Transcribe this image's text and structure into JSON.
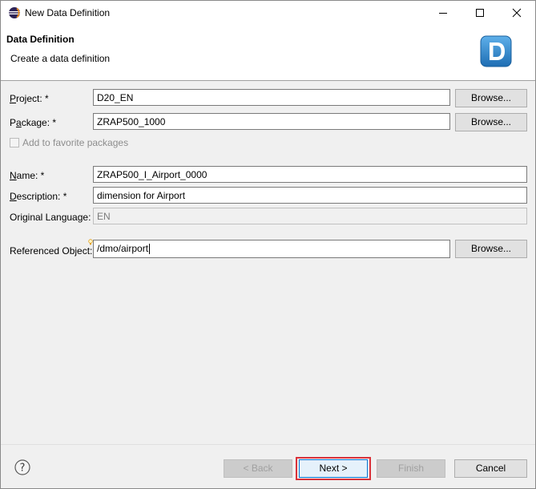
{
  "window": {
    "title": "New Data Definition",
    "icons": {
      "app": "eclipse-icon",
      "minimize": "minimize-icon",
      "maximize": "maximize-icon",
      "close": "close-icon"
    }
  },
  "banner": {
    "title": "Data Definition",
    "subtitle": "Create a data definition",
    "logo_letter": "D"
  },
  "form": {
    "project": {
      "label_pre": "",
      "label_u": "P",
      "label_post": "roject: *",
      "value": "D20_EN",
      "browse": "Browse..."
    },
    "package": {
      "label_pre": "P",
      "label_u": "a",
      "label_post": "ckage: *",
      "value": "ZRAP500_1000",
      "browse": "Browse..."
    },
    "favorite": {
      "label": "Add to favorite packages",
      "checked": false
    },
    "name": {
      "label_pre": "",
      "label_u": "N",
      "label_post": "ame: *",
      "value": "ZRAP500_I_Airport_0000"
    },
    "description": {
      "label_pre": "",
      "label_u": "D",
      "label_post": "escription: *",
      "value": "dimension for Airport"
    },
    "original_language": {
      "label": "Original Language:",
      "value": "EN"
    },
    "referenced_object": {
      "label": "Referenced Object:",
      "value": "/dmo/airport",
      "browse": "Browse..."
    }
  },
  "footer": {
    "help_icon": "help-icon",
    "back": "< Back",
    "next": "Next >",
    "finish": "Finish",
    "cancel": "Cancel"
  },
  "colors": {
    "highlight": "#d9323a",
    "logo_blue": "#2a7fc4"
  }
}
